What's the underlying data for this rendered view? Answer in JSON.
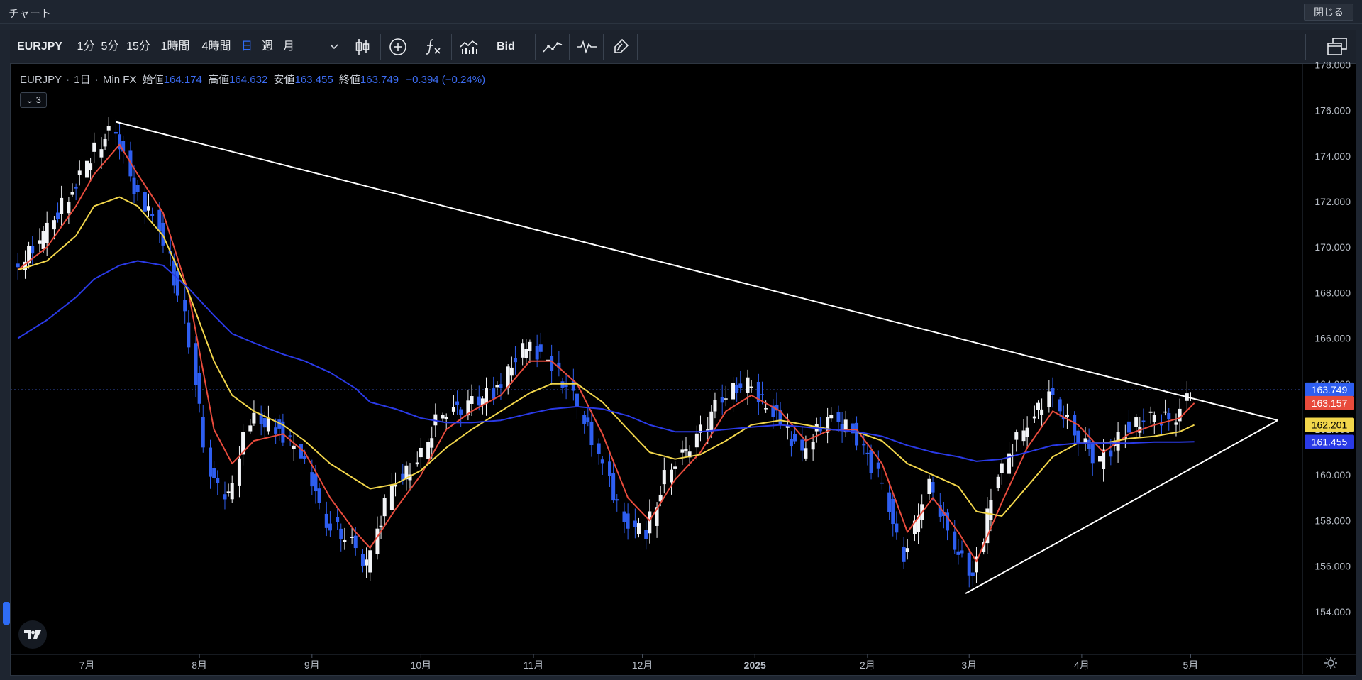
{
  "window": {
    "title": "チャート",
    "close_label": "閉じる"
  },
  "toolbar": {
    "symbol": "EURJPY",
    "intervals": [
      "1分",
      "5分",
      "15分",
      "1時間",
      "4時間",
      "日",
      "週",
      "月"
    ],
    "active_interval": "日",
    "bid_label": "Bid",
    "icons": [
      "chevron-down-icon",
      "candlestick-icon",
      "plus-circle-icon",
      "function-icon",
      "bar-chart-icon",
      "line-tool-icon",
      "indicator-icon",
      "brush-icon",
      "multi-window-icon"
    ]
  },
  "legend": {
    "symbol": "EURJPY",
    "interval": "1日",
    "source": "Min FX",
    "open_label": "始値",
    "open": "164.174",
    "high_label": "高値",
    "high": "164.632",
    "low_label": "安値",
    "low": "163.455",
    "close_label": "終値",
    "close": "163.749",
    "change": "−0.394 (−0.24%)",
    "indicators_count": "3"
  },
  "chart_data": {
    "type": "line",
    "title": "",
    "xlabel": "",
    "ylabel": "",
    "ylim": [
      153,
      178
    ],
    "y_ticks": [
      "154.000",
      "156.000",
      "158.000",
      "160.000",
      "162.000",
      "164.000",
      "166.000",
      "168.000",
      "170.000",
      "172.000",
      "174.000",
      "176.000",
      "178.000"
    ],
    "x_ticks": [
      "7月",
      "8月",
      "9月",
      "10月",
      "11月",
      "12月",
      "2025",
      "2月",
      "3月",
      "4月",
      "5月"
    ],
    "x_tick_dates": [
      "2024-07-01",
      "2024-08-01",
      "2024-09-01",
      "2024-10-01",
      "2024-11-01",
      "2024-12-01",
      "2025-01-01",
      "2025-02-01",
      "2025-03-01",
      "2025-04-01",
      "2025-05-01"
    ],
    "price_close_series": {
      "dates": [
        "2024-06-12",
        "2024-06-20",
        "2024-06-28",
        "2024-07-03",
        "2024-07-10",
        "2024-07-15",
        "2024-07-22",
        "2024-07-29",
        "2024-08-05",
        "2024-08-10",
        "2024-08-16",
        "2024-08-24",
        "2024-08-30",
        "2024-09-06",
        "2024-09-13",
        "2024-09-17",
        "2024-09-24",
        "2024-10-01",
        "2024-10-08",
        "2024-10-15",
        "2024-10-23",
        "2024-10-31",
        "2024-11-06",
        "2024-11-13",
        "2024-11-20",
        "2024-11-27",
        "2024-12-03",
        "2024-12-10",
        "2024-12-17",
        "2024-12-24",
        "2024-12-31",
        "2025-01-08",
        "2025-01-15",
        "2025-01-22",
        "2025-01-29",
        "2025-02-05",
        "2025-02-12",
        "2025-02-19",
        "2025-02-26",
        "2025-03-03",
        "2025-03-10",
        "2025-03-17",
        "2025-03-24",
        "2025-03-31",
        "2025-04-07",
        "2025-04-14",
        "2025-04-21",
        "2025-04-28",
        "2025-05-02"
      ],
      "values": [
        169.0,
        170.5,
        172.5,
        174.0,
        175.3,
        172.5,
        171.0,
        167.0,
        160.0,
        159.0,
        162.5,
        162.0,
        161.0,
        158.0,
        157.0,
        156.0,
        159.5,
        160.5,
        162.8,
        163.0,
        163.8,
        165.8,
        165.0,
        163.5,
        161.0,
        158.0,
        157.5,
        160.5,
        161.5,
        163.5,
        164.0,
        162.5,
        161.0,
        162.5,
        162.0,
        160.0,
        156.5,
        159.5,
        157.0,
        155.5,
        160.0,
        162.0,
        163.5,
        162.0,
        160.5,
        162.0,
        162.5,
        162.5,
        163.75
      ]
    },
    "series": [
      {
        "name": "",
        "color": "#e84b3c",
        "values": [
          169.0,
          170.0,
          171.8,
          173.2,
          174.5,
          173.2,
          171.5,
          168.0,
          162.0,
          160.5,
          161.5,
          161.8,
          161.0,
          159.0,
          157.5,
          156.8,
          158.5,
          160.0,
          162.0,
          162.8,
          163.5,
          165.0,
          165.0,
          164.0,
          161.8,
          159.0,
          158.0,
          159.8,
          161.0,
          162.8,
          163.5,
          162.8,
          161.5,
          162.0,
          162.0,
          160.5,
          157.5,
          159.0,
          157.5,
          156.2,
          158.8,
          161.2,
          162.8,
          162.2,
          161.0,
          161.8,
          162.2,
          162.5,
          163.16
        ]
      },
      {
        "name": "",
        "color": "#f2d64b",
        "values": [
          169.0,
          169.4,
          170.5,
          171.8,
          172.2,
          171.8,
          170.5,
          168.0,
          165.0,
          163.5,
          162.8,
          162.2,
          161.5,
          160.5,
          159.8,
          159.4,
          159.6,
          160.2,
          161.2,
          162.0,
          162.8,
          163.6,
          164.0,
          164.0,
          163.2,
          162.0,
          161.0,
          160.7,
          160.9,
          161.5,
          162.2,
          162.4,
          162.2,
          162.0,
          161.9,
          161.5,
          160.5,
          160.0,
          159.5,
          158.4,
          158.2,
          159.5,
          160.8,
          161.4,
          161.4,
          161.6,
          161.7,
          161.9,
          162.2
        ]
      },
      {
        "name": "",
        "color": "#2a3ae6",
        "values": [
          166.0,
          166.8,
          167.8,
          168.6,
          169.2,
          169.4,
          169.2,
          168.2,
          167.0,
          166.2,
          165.8,
          165.3,
          165.0,
          164.5,
          163.8,
          163.2,
          162.9,
          162.5,
          162.3,
          162.3,
          162.4,
          162.7,
          162.9,
          163.0,
          162.9,
          162.6,
          162.2,
          161.9,
          161.9,
          162.0,
          162.1,
          162.2,
          162.1,
          162.0,
          161.9,
          161.7,
          161.3,
          161.0,
          160.8,
          160.6,
          160.7,
          161.0,
          161.3,
          161.4,
          161.4,
          161.4,
          161.45,
          161.45,
          161.46
        ]
      }
    ],
    "trendlines": [
      {
        "from": [
          "2024-07-09",
          175.5
        ],
        "to": [
          "2025-05-25",
          162.4
        ]
      },
      {
        "from": [
          "2025-02-28",
          154.8
        ],
        "to": [
          "2025-05-25",
          162.4
        ]
      }
    ],
    "price_labels": [
      {
        "value": "163.749",
        "color": "#2e5ef0",
        "text_color": "#ffffff"
      },
      {
        "value": "163.157",
        "color": "#e84b3c",
        "text_color": "#ffffff"
      },
      {
        "value": "162.201",
        "color": "#f2d64b",
        "text_color": "#000000"
      },
      {
        "value": "161.455",
        "color": "#2a3ae6",
        "text_color": "#ffffff"
      }
    ],
    "last_price": 163.749,
    "grid": false,
    "legend_position": "top-left"
  }
}
